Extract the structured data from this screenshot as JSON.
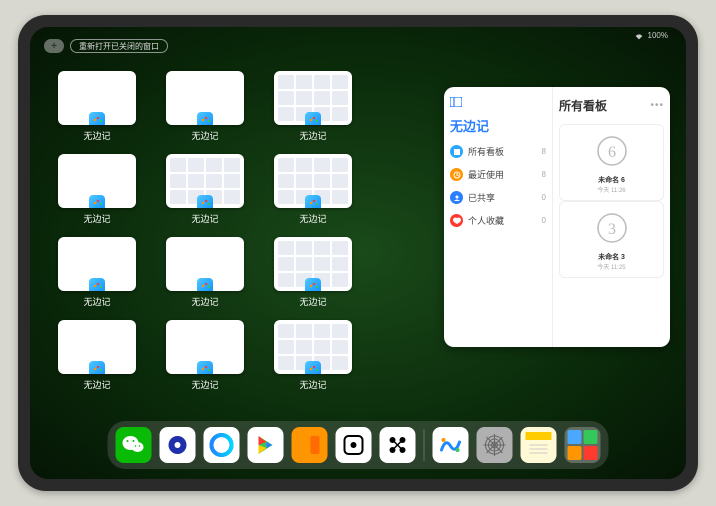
{
  "statusbar": {
    "wifi": "wifi-icon",
    "battery": "100%"
  },
  "top_controls": {
    "plus": "+",
    "reopen_label": "重新打开已关闭的窗口"
  },
  "app": {
    "name": "无边记"
  },
  "grid": {
    "rows": [
      [
        {
          "label": "无边记",
          "style": "blank"
        },
        {
          "label": "无边记",
          "style": "blank"
        },
        {
          "label": "无边记",
          "style": "grid"
        }
      ],
      [
        {
          "label": "无边记",
          "style": "blank"
        },
        {
          "label": "无边记",
          "style": "grid"
        },
        {
          "label": "无边记",
          "style": "grid"
        }
      ],
      [
        {
          "label": "无边记",
          "style": "blank"
        },
        {
          "label": "无边记",
          "style": "blank"
        },
        {
          "label": "无边记",
          "style": "grid"
        }
      ],
      [
        {
          "label": "无边记",
          "style": "blank"
        },
        {
          "label": "无边记",
          "style": "blank"
        },
        {
          "label": "无边记",
          "style": "grid"
        }
      ]
    ]
  },
  "panel": {
    "left_title": "无边记",
    "categories": [
      {
        "label": "所有看板",
        "count": "8",
        "color": "#2aa8ff"
      },
      {
        "label": "最近使用",
        "count": "8",
        "color": "#ff9500"
      },
      {
        "label": "已共享",
        "count": "0",
        "color": "#2a7fff"
      },
      {
        "label": "个人收藏",
        "count": "0",
        "color": "#ff3b30"
      }
    ],
    "right_title": "所有看板",
    "boards": [
      {
        "name": "未命名 6",
        "time": "今天 11:26",
        "digit": "6"
      },
      {
        "name": "未命名 3",
        "time": "今天 11:25",
        "digit": "3"
      }
    ]
  },
  "dock": {
    "apps": [
      {
        "name": "wechat",
        "color": "#09bb07"
      },
      {
        "name": "quark",
        "color": "#ffffff"
      },
      {
        "name": "qq-browser",
        "color": "#ffffff"
      },
      {
        "name": "play",
        "color": "#ffffff"
      },
      {
        "name": "books",
        "color": "#ff9500"
      },
      {
        "name": "dice",
        "color": "#ffffff"
      },
      {
        "name": "element",
        "color": "#ffffff"
      },
      {
        "name": "freeform",
        "color": "#ffffff"
      },
      {
        "name": "settings",
        "color": "#b0b0b0"
      },
      {
        "name": "notes",
        "color": "#fff9d6"
      }
    ]
  }
}
